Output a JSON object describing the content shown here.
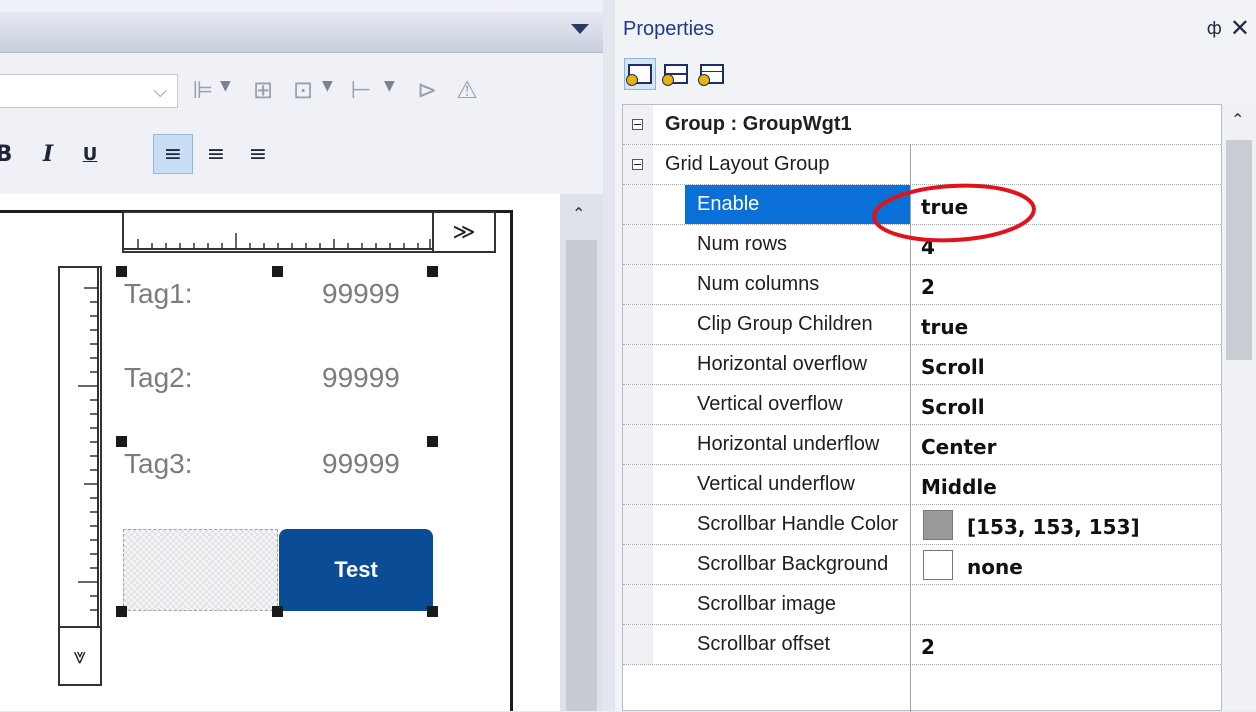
{
  "properties_panel": {
    "title": "Properties",
    "pin_glyph": "ф",
    "close_glyph": "✕",
    "toolbar_icons": [
      "property-view-icon",
      "widget-properties-icon",
      "event-view-icon"
    ],
    "group_header": "Group : GroupWgt1",
    "section_header": "Grid Layout Group",
    "rows": [
      {
        "name": "Enable",
        "value": "true",
        "selected": true
      },
      {
        "name": "Num rows",
        "value": "4"
      },
      {
        "name": "Num columns",
        "value": "2"
      },
      {
        "name": "Clip Group Children",
        "value": "true"
      },
      {
        "name": "Horizontal overflow",
        "value": "Scroll"
      },
      {
        "name": "Vertical overflow",
        "value": "Scroll"
      },
      {
        "name": "Horizontal underflow",
        "value": "Center"
      },
      {
        "name": "Vertical underflow",
        "value": "Middle"
      },
      {
        "name": "Scrollbar Handle Color",
        "value": "[153, 153, 153]",
        "swatch": "#999999"
      },
      {
        "name": "Scrollbar Background",
        "value": "none",
        "swatch": "#ffffff"
      },
      {
        "name": "Scrollbar image",
        "value": ""
      },
      {
        "name": "Scrollbar offset",
        "value": "2"
      }
    ]
  },
  "designer": {
    "toolbar_icons": [
      "align-left-icon",
      "center-icon",
      "distribute-icon",
      "spacing-icon",
      "flip-horizontal-icon",
      "flip-vertical-icon"
    ],
    "format_buttons": {
      "bold": "B",
      "italic": "I",
      "underline": "U",
      "align_left": "≡",
      "align_center": "≡",
      "align_right": "≡"
    },
    "ruler_expand_h": "≫",
    "ruler_expand_v": "⩔",
    "widgets": {
      "tag1_label": "Tag1:",
      "tag1_value": "99999",
      "tag2_label": "Tag2:",
      "tag2_value": "99999",
      "tag3_label": "Tag3:",
      "tag3_value": "99999",
      "button_label": "Test"
    }
  },
  "colors": {
    "selection": "#0a6fd6",
    "button": "#0b4c96",
    "annotation_circle": "#e0121a",
    "title_text": "#1e3a8a"
  }
}
